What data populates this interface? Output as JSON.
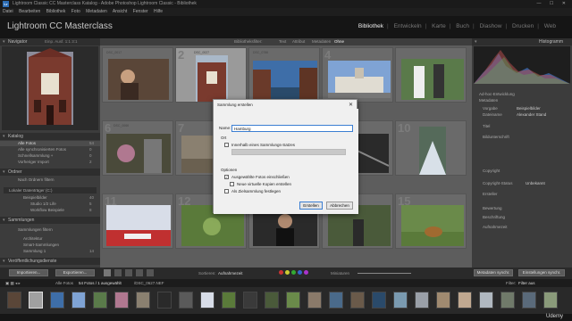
{
  "window": {
    "title": "Lightroom Classic CC Masterclass Katalog - Adobe Photoshop Lightroom Classic - Bibliothek",
    "logo": "Lr",
    "controls": "—  ☐  ✕"
  },
  "menu": [
    "Datei",
    "Bearbeiten",
    "Bibliothek",
    "Foto",
    "Metadaten",
    "Ansicht",
    "Fenster",
    "Hilfe"
  ],
  "app": {
    "name": "Lightroom CC Masterclass"
  },
  "modules": [
    {
      "label": "Bibliothek",
      "active": true
    },
    {
      "label": "Entwickeln"
    },
    {
      "label": "Karte"
    },
    {
      "label": "Buch"
    },
    {
      "label": "Diashow"
    },
    {
      "label": "Drucken"
    },
    {
      "label": "Web"
    }
  ],
  "navigator": {
    "title": "Navigator",
    "options": "Einp.  Ausf.  1:1  3:1"
  },
  "catalog": {
    "title": "Katalog",
    "items": [
      {
        "label": "Alle Fotos",
        "count": "54"
      },
      {
        "label": "Alle synchronisierten Fotos",
        "count": "0"
      },
      {
        "label": "Schnellsammlung +",
        "count": "0"
      },
      {
        "label": "Vorheriger Import",
        "count": "2"
      }
    ]
  },
  "folders": {
    "title": "Ordner",
    "items": [
      {
        "label": "Nach Ordnern filtern",
        "count": ""
      },
      {
        "label": "Lokaler Datenträger (C:)",
        "count": ""
      },
      {
        "label": "Beispielbilder",
        "count": "40"
      },
      {
        "label": "Studio 1/2 Life",
        "count": "5"
      },
      {
        "label": "Workflow Beispiele",
        "count": "8"
      }
    ]
  },
  "collections": {
    "title": "Sammlungen",
    "items": [
      {
        "label": "Sammlungen filtern",
        "count": ""
      },
      {
        "label": "Architektur",
        "count": ""
      },
      {
        "label": "Smart-Sammlungen",
        "count": ""
      },
      {
        "label": "Sammlung 1",
        "count": "14"
      }
    ]
  },
  "publish": {
    "title": "Veröffentlichungsdienste"
  },
  "filterbar": {
    "label": "Bibliotheksfilter:",
    "options": [
      "Text",
      "Attribut",
      "Metadaten",
      "Ohne"
    ],
    "active": "Ohne"
  },
  "grid": {
    "cells": [
      {
        "num": "",
        "label": "DSC_0017"
      },
      {
        "num": "2",
        "label": "DSC_0027"
      },
      {
        "num": "",
        "label": "DSC_0786"
      },
      {
        "num": "4",
        "label": ""
      },
      {
        "num": "",
        "label": ""
      },
      {
        "num": "6",
        "label": "DSC_0066"
      },
      {
        "num": "7",
        "label": ""
      },
      {
        "num": "",
        "label": ""
      },
      {
        "num": "9",
        "label": ""
      },
      {
        "num": "10",
        "label": ""
      },
      {
        "num": "11",
        "label": ""
      },
      {
        "num": "12",
        "label": ""
      },
      {
        "num": "13",
        "label": ""
      },
      {
        "num": "14",
        "label": ""
      },
      {
        "num": "15",
        "label": ""
      }
    ]
  },
  "histogram": {
    "title": "Histogramm"
  },
  "rightpanel": {
    "rows": [
      {
        "label": "Ad-hoc-Entwicklung",
        "value": ""
      },
      {
        "label": "Metadaten",
        "value": ""
      },
      {
        "label": "Vorgabe",
        "value": "Beispielbilder"
      },
      {
        "label": "Dateiname",
        "value": "Alexander Stand"
      },
      {
        "label": "Titel",
        "value": ""
      },
      {
        "label": "Bildunterschrift",
        "value": ""
      },
      {
        "label": "Copyright",
        "value": ""
      },
      {
        "label": "Copyright-Status",
        "value": "Unbekannt"
      },
      {
        "label": "Ersteller",
        "value": ""
      },
      {
        "label": "Bewertung",
        "value": ""
      },
      {
        "label": "Beschriftung",
        "value": ""
      },
      {
        "label": "Aufnahmezeit",
        "value": ""
      },
      {
        "label": "Kamera",
        "value": "NIKON D90"
      },
      {
        "label": "Objektiv",
        "value": "18.0-55.0 mm f/3.5-5.6"
      }
    ]
  },
  "toolbar": {
    "import": "Importieren...",
    "export": "Exportieren...",
    "sort_label": "Sortieren:",
    "sort_value": "Aufnahmezeit",
    "thumbs": "Miniaturen",
    "sync_meta": "Metadaten synchr.",
    "sync_settings": "Einstellungen synchr."
  },
  "filmstrip": {
    "source": "Alle Fotos",
    "count": "54 Fotos / 1 ausgewählt",
    "file": "/DSC_0627.NEF",
    "filter_label": "Filter:",
    "filter_value": "Filter aus"
  },
  "dialog": {
    "title": "Sammlung erstellen",
    "name_label": "Name:",
    "name_value": "Hamburg",
    "set_label": "Ort",
    "set_check": "Innerhalb eines Sammlungs-Satzes",
    "options_label": "Optionen",
    "opt1": "Ausgewählte Fotos einschließen",
    "opt2": "Neue virtuelle Kopien erstellen",
    "opt3": "Als Zielsammlung festlegen",
    "create": "Erstellen",
    "cancel": "Abbrechen"
  },
  "watermark": "Udemy"
}
